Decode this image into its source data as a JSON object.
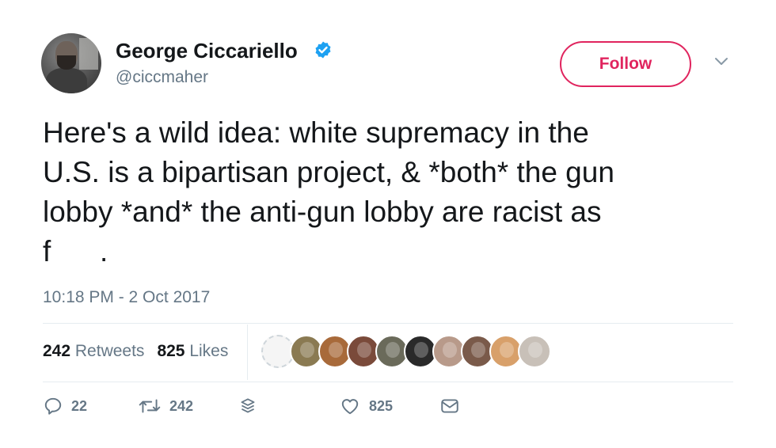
{
  "author": {
    "name": "George Ciccariello",
    "handle": "@ciccmaher",
    "verified": true
  },
  "follow_button": {
    "label": "Follow"
  },
  "tweet": {
    "lines": [
      "Here's a wild idea: white supremacy in the",
      "U.S. is a bipartisan project, & *both* the gun",
      "lobby *and* the anti-gun lobby are racist as",
      "f      ."
    ],
    "timestamp": "10:18 PM - 2 Oct 2017"
  },
  "stats": {
    "retweets_count": "242",
    "retweets_label": "Retweets",
    "likes_count": "825",
    "likes_label": "Likes"
  },
  "liker_avatars": [
    "#ffffff",
    "#8a7a52",
    "#a86a3a",
    "#7a4a3a",
    "#6a6a5a",
    "#2a2a2a",
    "#b89a8a",
    "#7a5a4a",
    "#d8a06a",
    "#c8c0b8"
  ],
  "actions": {
    "reply_count": "22",
    "retweet_count": "242",
    "like_count": "825"
  },
  "colors": {
    "accent_follow": "#e0245e",
    "verified_blue": "#1da1f2",
    "secondary_text": "#657786"
  },
  "icons": [
    "verified-badge-icon",
    "chevron-down-icon",
    "reply-icon",
    "retweet-icon",
    "layers-icon",
    "heart-icon",
    "envelope-icon"
  ]
}
